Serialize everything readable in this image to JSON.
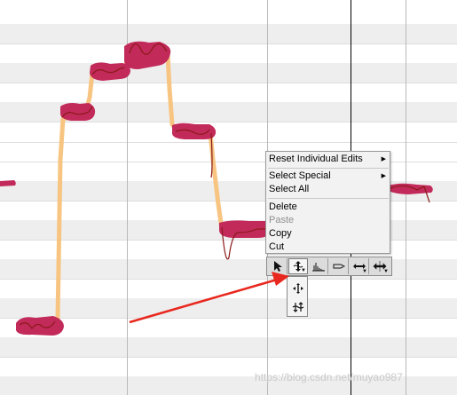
{
  "context_menu": {
    "items": [
      {
        "label": "Reset Individual Edits",
        "submenu": true,
        "enabled": true
      },
      {
        "label": "Select Special",
        "submenu": true,
        "enabled": true
      },
      {
        "label": "Select All",
        "submenu": false,
        "enabled": true
      },
      {
        "label": "Delete",
        "submenu": false,
        "enabled": true
      },
      {
        "label": "Paste",
        "submenu": false,
        "enabled": false
      },
      {
        "label": "Copy",
        "submenu": false,
        "enabled": true
      },
      {
        "label": "Cut",
        "submenu": false,
        "enabled": true
      }
    ]
  },
  "toolbar": {
    "tools": [
      {
        "name": "main-tool",
        "icon": "pointer-arrow-icon"
      },
      {
        "name": "pitch-tool",
        "icon": "pitch-move-icon",
        "selected": true
      },
      {
        "name": "formant-tool",
        "icon": "formant-icon"
      },
      {
        "name": "amplitude-tool",
        "icon": "amplitude-icon"
      },
      {
        "name": "time-tool",
        "icon": "time-stretch-icon"
      },
      {
        "name": "separation-tool",
        "icon": "separation-icon"
      }
    ],
    "subtools": [
      {
        "name": "pitch-modulation-tool",
        "icon": "pitch-modulation-icon"
      },
      {
        "name": "pitch-drift-tool",
        "icon": "pitch-drift-icon"
      }
    ]
  },
  "colors": {
    "note_blob": "#c22a5a",
    "pitch_curve": "#8b1a1a",
    "pitch_line_highlight": "#f7c27a",
    "annotation_arrow": "#e8281e"
  },
  "watermark": "https://blog.csdn.net/muyao987"
}
